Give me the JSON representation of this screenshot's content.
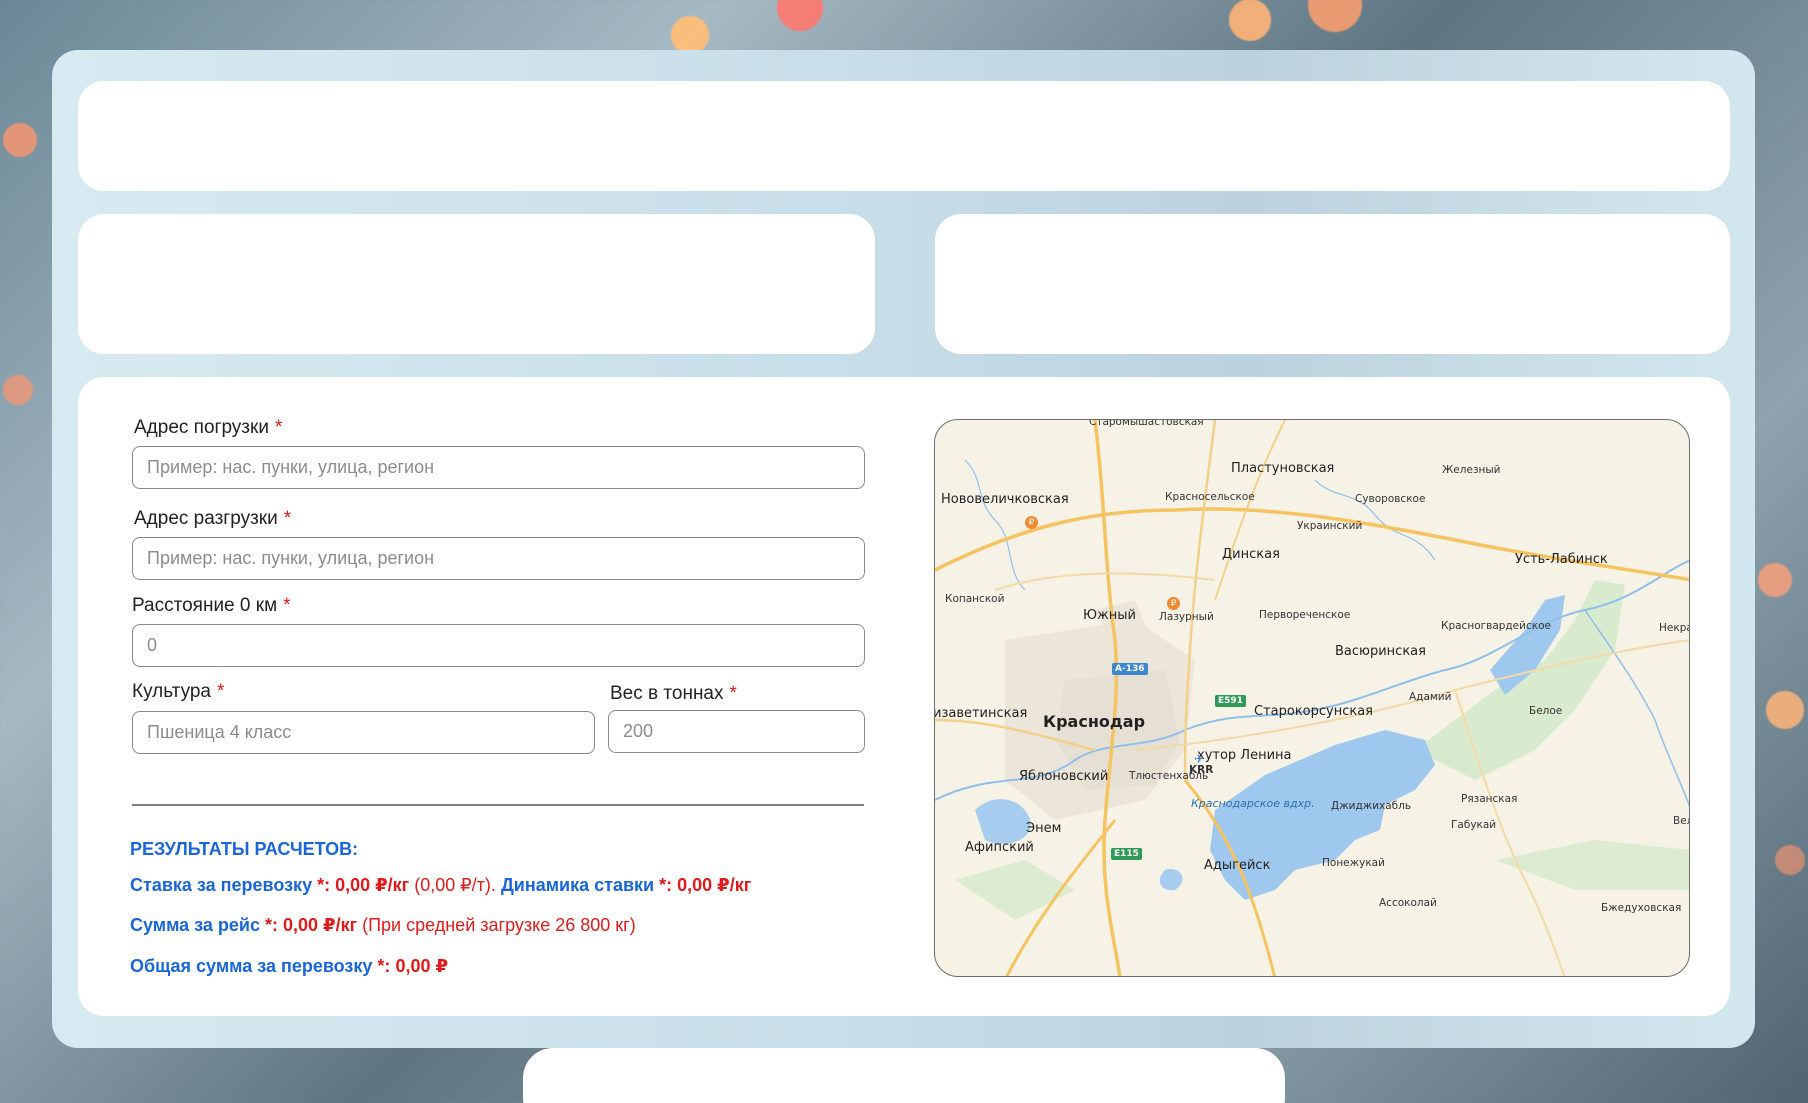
{
  "form": {
    "load_address": {
      "label": "Адрес погрузки",
      "required": "*",
      "placeholder": "Пример: нас. пунки, улица, регион"
    },
    "unload_address": {
      "label": "Адрес разгрузки",
      "required": "*",
      "placeholder": "Пример: нас. пунки, улица, регион"
    },
    "distance": {
      "label": "Расстояние 0 км",
      "required": "*",
      "placeholder": "0"
    },
    "culture": {
      "label": "Культура",
      "required": "*",
      "placeholder": "Пшеница 4 класс"
    },
    "weight": {
      "label": "Вес в тоннах",
      "required": "*",
      "placeholder": "200"
    }
  },
  "results": {
    "title": "РЕЗУЛЬТАТЫ РАСЧЕТОВ:",
    "rate": {
      "label": "Ставка за перевозку",
      "star": "*:",
      "value": "0,00 ₽/кг",
      "extra": "(0,00 ₽/т).",
      "dyn_label": "Динамика ставки",
      "dyn_star": "*:",
      "dyn_value": "0,00 ₽/кг"
    },
    "trip": {
      "label": "Сумма за рейс",
      "star": "*:",
      "value": "0,00 ₽/кг",
      "extra": "(При средней загрузке 26 800 кг)"
    },
    "total": {
      "label": "Общая сумма за перевозку",
      "star": "*:",
      "value": "0,00 ₽"
    }
  },
  "map": {
    "main_city": "Краснодар",
    "places_mid": [
      "Старомышастовская",
      "Пластуновская",
      "Нововеличковская",
      "Динская",
      "Усть-Лабинск",
      "Южный",
      "Васюринская",
      "Старокорсунская",
      "хутор Ленина",
      "Яблоновский",
      "Энем",
      "Афипский",
      "Адыгейск",
      "изаветинская"
    ],
    "places_small": [
      "Железный",
      "Красносельское",
      "Суворовское",
      "Украинский",
      "Копанской",
      "Лазурный",
      "Первореченское",
      "Красногвардейское",
      "Некра",
      "Адамий",
      "Белое",
      "Тлюстенхабль",
      "Джиджихабль",
      "Рязанская",
      "Габукай",
      "Велик",
      "Понежукай",
      "Ассоколай",
      "Бжедуховская"
    ],
    "reservoir": "Краснодарское вдхр.",
    "roads": [
      "А-136",
      "E591",
      "E115"
    ],
    "airport": "KRR",
    "fuel_icon": "₽"
  },
  "colors": {
    "accent_blue": "#1a66d9",
    "accent_red": "#e11b1b"
  }
}
